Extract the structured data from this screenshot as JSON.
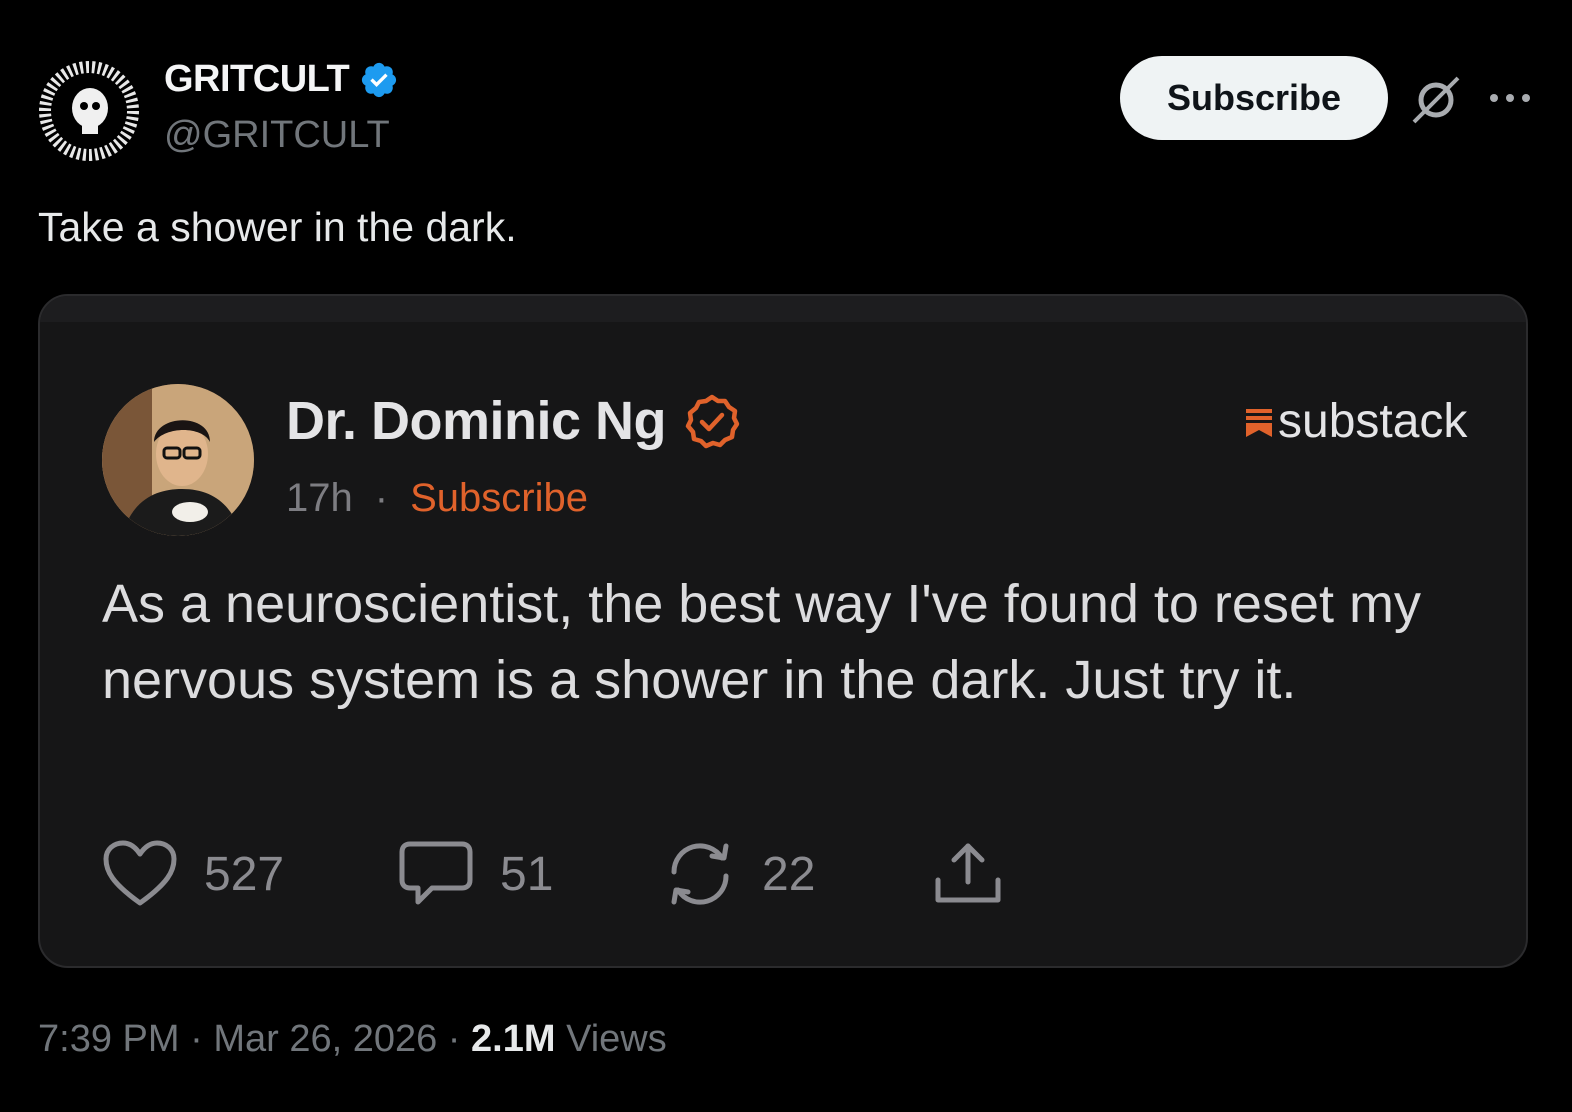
{
  "author": {
    "name": "GRITCULT",
    "handle": "@GRITCULT",
    "verified_icon": "verified-badge-icon",
    "accent": "#1d9bf0"
  },
  "header": {
    "subscribe_label": "Subscribe",
    "grok_icon": "grok-icon",
    "more_icon": "more-icon"
  },
  "tweet": {
    "text": "Take a shower in the dark."
  },
  "quoted": {
    "name": "Dr. Dominic Ng",
    "time": "17h",
    "separator": "·",
    "subscribe_label": "Subscribe",
    "platform": "substack",
    "accent": "#e0622b",
    "body": "As a neuroscientist, the best way I've found to reset my nervous system is a shower in the dark. Just try it.",
    "likes": "527",
    "comments": "51",
    "restacks": "22"
  },
  "footer": {
    "time": "7:39 PM",
    "date": "Mar 26, 2026",
    "dot": "·",
    "views_count": "2.1M",
    "views_label": "Views"
  }
}
